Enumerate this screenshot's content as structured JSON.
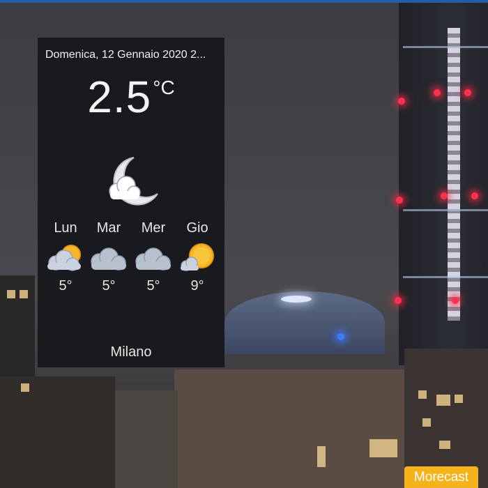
{
  "widget": {
    "date": "Domenica, 12 Gennaio 2020 2...",
    "temperature": "2.5",
    "unit": "°C",
    "current_icon": "cloud-moon-icon",
    "city": "Milano",
    "forecast": [
      {
        "day": "Lun",
        "temp": "5°",
        "icon": "partly-cloudy-sun-icon"
      },
      {
        "day": "Mar",
        "temp": "5°",
        "icon": "cloudy-icon"
      },
      {
        "day": "Mer",
        "temp": "5°",
        "icon": "cloudy-icon"
      },
      {
        "day": "Gio",
        "temp": "9°",
        "icon": "sun-cloud-icon"
      }
    ]
  },
  "brand": {
    "label": "Morecast"
  },
  "colors": {
    "accent": "#f4b31a",
    "topbar": "#1f5fa8",
    "sun": "#f6b828",
    "cloud": "#b9c2cf"
  }
}
